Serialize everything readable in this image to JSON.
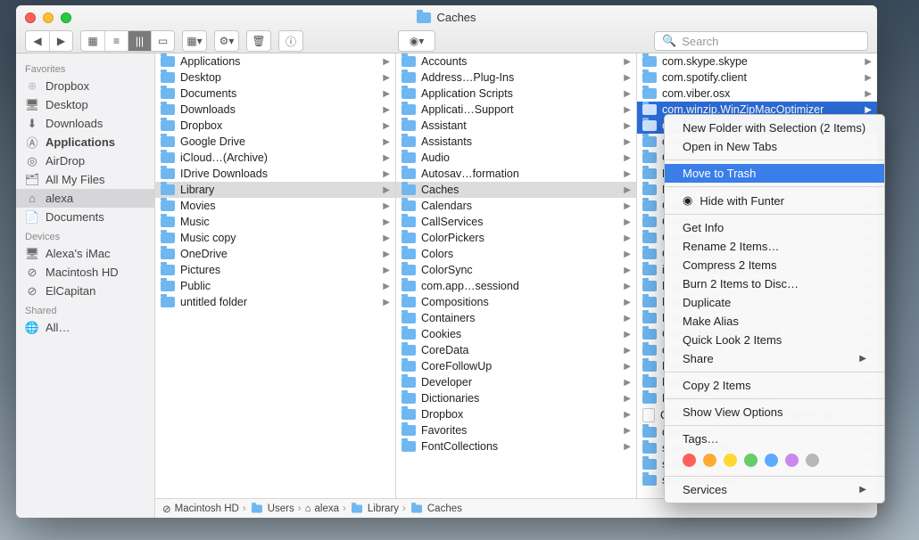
{
  "window": {
    "title": "Caches"
  },
  "toolbar": {
    "search_placeholder": "Search"
  },
  "sidebar": {
    "sections": [
      {
        "heading": "Favorites",
        "items": [
          {
            "icon": "dropbox",
            "label": "Dropbox"
          },
          {
            "icon": "desktop",
            "label": "Desktop"
          },
          {
            "icon": "downloads",
            "label": "Downloads"
          },
          {
            "icon": "apps",
            "label": "Applications",
            "bold": true
          },
          {
            "icon": "airdrop",
            "label": "AirDrop"
          },
          {
            "icon": "allfiles",
            "label": "All My Files"
          },
          {
            "icon": "home",
            "label": "alexa",
            "selected": true
          },
          {
            "icon": "docs",
            "label": "Documents"
          }
        ]
      },
      {
        "heading": "Devices",
        "items": [
          {
            "icon": "imac",
            "label": "Alexa's iMac"
          },
          {
            "icon": "disk",
            "label": "Macintosh HD"
          },
          {
            "icon": "disk",
            "label": "ElCapitan"
          }
        ]
      },
      {
        "heading": "Shared",
        "items": [
          {
            "icon": "globe",
            "label": "All…"
          }
        ]
      }
    ]
  },
  "columns": [
    {
      "items": [
        {
          "t": "folder",
          "label": "Applications",
          "arrow": true
        },
        {
          "t": "folder",
          "label": "Desktop",
          "arrow": true
        },
        {
          "t": "folder",
          "label": "Documents",
          "arrow": true
        },
        {
          "t": "folder",
          "label": "Downloads",
          "arrow": true
        },
        {
          "t": "folder",
          "label": "Dropbox",
          "arrow": true
        },
        {
          "t": "folder",
          "label": "Google Drive",
          "arrow": true
        },
        {
          "t": "folder",
          "label": "iCloud…(Archive)",
          "arrow": true
        },
        {
          "t": "folder",
          "label": "IDrive Downloads",
          "arrow": true
        },
        {
          "t": "folder",
          "label": "Library",
          "arrow": true,
          "selected": true
        },
        {
          "t": "folder",
          "label": "Movies",
          "arrow": true
        },
        {
          "t": "folder",
          "label": "Music",
          "arrow": true
        },
        {
          "t": "folder",
          "label": "Music copy",
          "arrow": true
        },
        {
          "t": "disk",
          "label": "OneDrive",
          "arrow": true
        },
        {
          "t": "folder",
          "label": "Pictures",
          "arrow": true
        },
        {
          "t": "folder",
          "label": "Public",
          "arrow": true
        },
        {
          "t": "folder",
          "label": "untitled folder",
          "arrow": true
        }
      ]
    },
    {
      "items": [
        {
          "t": "folder",
          "label": "Accounts",
          "arrow": true
        },
        {
          "t": "folder",
          "label": "Address…Plug-Ins",
          "arrow": true
        },
        {
          "t": "folder",
          "label": "Application Scripts",
          "arrow": true
        },
        {
          "t": "folder",
          "label": "Applicati…Support",
          "arrow": true
        },
        {
          "t": "folder",
          "label": "Assistant",
          "arrow": true
        },
        {
          "t": "folder",
          "label": "Assistants",
          "arrow": true
        },
        {
          "t": "folder",
          "label": "Audio",
          "arrow": true
        },
        {
          "t": "folder",
          "label": "Autosav…formation",
          "arrow": true
        },
        {
          "t": "folder",
          "label": "Caches",
          "arrow": true,
          "selected": true
        },
        {
          "t": "folder",
          "label": "Calendars",
          "arrow": true
        },
        {
          "t": "folder",
          "label": "CallServices",
          "arrow": true
        },
        {
          "t": "folder",
          "label": "ColorPickers",
          "arrow": true
        },
        {
          "t": "folder",
          "label": "Colors",
          "arrow": true
        },
        {
          "t": "folder",
          "label": "ColorSync",
          "arrow": true
        },
        {
          "t": "folder",
          "label": "com.app…sessiond",
          "arrow": true
        },
        {
          "t": "folder",
          "label": "Compositions",
          "arrow": true
        },
        {
          "t": "folder",
          "label": "Containers",
          "arrow": true
        },
        {
          "t": "folder",
          "label": "Cookies",
          "arrow": true
        },
        {
          "t": "folder",
          "label": "CoreData",
          "arrow": true
        },
        {
          "t": "folder",
          "label": "CoreFollowUp",
          "arrow": true
        },
        {
          "t": "folder",
          "label": "Developer",
          "arrow": true
        },
        {
          "t": "folder",
          "label": "Dictionaries",
          "arrow": true
        },
        {
          "t": "folder",
          "label": "Dropbox",
          "arrow": true
        },
        {
          "t": "folder",
          "label": "Favorites",
          "arrow": true
        },
        {
          "t": "folder",
          "label": "FontCollections",
          "arrow": true
        }
      ]
    },
    {
      "items": [
        {
          "t": "folder",
          "label": "com.skype.skype",
          "arrow": true
        },
        {
          "t": "folder",
          "label": "com.spotify.client",
          "arrow": true
        },
        {
          "t": "folder",
          "label": "com.viber.osx",
          "arrow": true
        },
        {
          "t": "folder",
          "label": "com.winzip.WinZipMacOptimizer",
          "arrow": true,
          "selblue": true
        },
        {
          "t": "folder",
          "label": "com.winzip.WinZi…imizer.LoginHel",
          "arrow": true,
          "selblue": true
        },
        {
          "t": "folder",
          "label": "crashpad_handler",
          "arrow": true
        },
        {
          "t": "folder",
          "label": "CSXS",
          "arrow": true
        },
        {
          "t": "folder",
          "label": "FamilyCircle",
          "arrow": true
        },
        {
          "t": "folder",
          "label": "Firefox",
          "arrow": true
        },
        {
          "t": "folder",
          "label": "GameKit",
          "arrow": true
        },
        {
          "t": "folder",
          "label": "GeoServices",
          "arrow": true
        },
        {
          "t": "folder",
          "label": "Google",
          "arrow": true
        },
        {
          "t": "folder",
          "label": "Grammarly",
          "arrow": true
        },
        {
          "t": "folder",
          "label": "io.fabric.sdk.mac.data",
          "arrow": true
        },
        {
          "t": "folder",
          "label": "Maps",
          "arrow": true
        },
        {
          "t": "folder",
          "label": "Metadata",
          "arrow": true
        },
        {
          "t": "folder",
          "label": "Mozilla",
          "arrow": true
        },
        {
          "t": "folder",
          "label": "Oracle.MacJREInstaller",
          "arrow": true
        },
        {
          "t": "folder",
          "label": "org.herf.Flux",
          "arrow": true
        },
        {
          "t": "folder",
          "label": "Parse",
          "arrow": true
        },
        {
          "t": "folder",
          "label": "PassKit",
          "arrow": true
        },
        {
          "t": "folder",
          "label": "Photos_Cache.noindex",
          "arrow": true
        },
        {
          "t": "file",
          "label": "QCCompositionR…pple.iTunes.cac"
        },
        {
          "t": "folder",
          "label": "qlmanage",
          "arrow": true
        },
        {
          "t": "folder",
          "label": "storeaccountd",
          "arrow": true
        },
        {
          "t": "folder",
          "label": "storeassetd",
          "arrow": true
        },
        {
          "t": "folder",
          "label": "storedownloadd",
          "arrow": true
        }
      ]
    }
  ],
  "pathbar": [
    "Macintosh HD",
    "Users",
    "alexa",
    "Library",
    "Caches"
  ],
  "context_menu": {
    "groups": [
      [
        {
          "label": "New Folder with Selection (2 Items)"
        },
        {
          "label": "Open in New Tabs"
        }
      ],
      [
        {
          "label": "Move to Trash",
          "selected": true
        }
      ],
      [
        {
          "label": "Hide with Funter",
          "icon": "eye"
        }
      ],
      [
        {
          "label": "Get Info"
        },
        {
          "label": "Rename 2 Items…"
        },
        {
          "label": "Compress 2 Items"
        },
        {
          "label": "Burn 2 Items to Disc…"
        },
        {
          "label": "Duplicate"
        },
        {
          "label": "Make Alias"
        },
        {
          "label": "Quick Look 2 Items"
        },
        {
          "label": "Share",
          "submenu": true
        }
      ],
      [
        {
          "label": "Copy 2 Items"
        }
      ],
      [
        {
          "label": "Show View Options"
        }
      ],
      [
        {
          "label": "Tags…",
          "tags": true
        }
      ],
      [
        {
          "label": "Services",
          "submenu": true
        }
      ]
    ],
    "tag_colors": [
      "#ff5f5a",
      "#ffaa33",
      "#ffd633",
      "#66cc66",
      "#5aaaff",
      "#cc88ee",
      "#b8b8b8"
    ]
  }
}
